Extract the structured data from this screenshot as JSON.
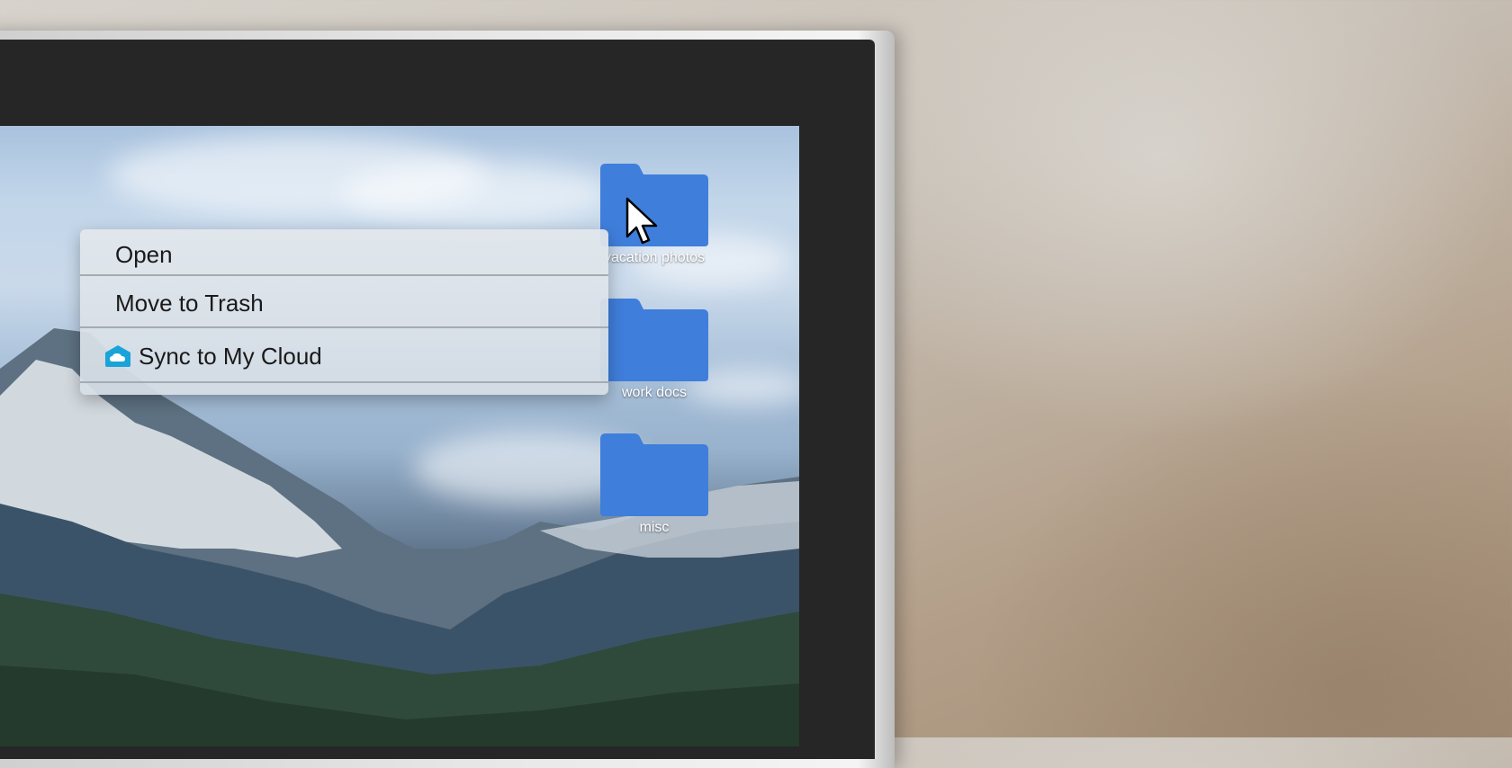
{
  "context_menu": {
    "items": [
      {
        "label": "Open"
      },
      {
        "label": "Move to Trash"
      },
      {
        "label": "Sync to My Cloud",
        "icon": "cloud-icon"
      }
    ]
  },
  "desktop": {
    "folders": [
      {
        "label": "vacation photos",
        "icon": "folder-icon"
      },
      {
        "label": "work docs",
        "icon": "folder-icon"
      },
      {
        "label": "misc",
        "icon": "folder-icon"
      }
    ]
  },
  "colors": {
    "folder_blue": "#3f7edb",
    "cloud_icon": "#1aa3d9"
  },
  "cursor": {
    "icon": "arrow-cursor-icon"
  }
}
